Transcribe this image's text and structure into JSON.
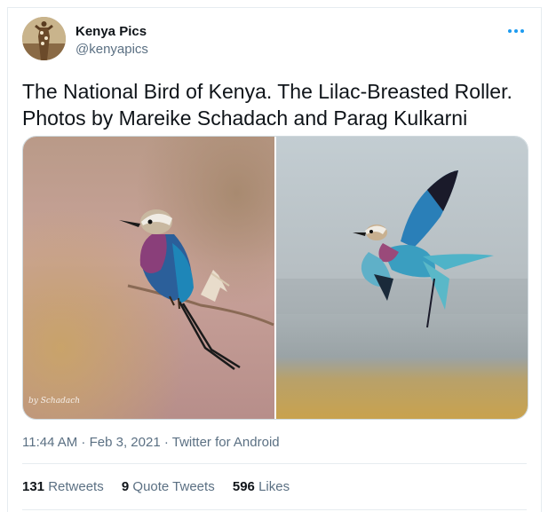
{
  "author": {
    "display_name": "Kenya Pics",
    "handle": "@kenyapics"
  },
  "menu": {
    "more_icon": "ellipsis-icon"
  },
  "tweet": {
    "text_line1": "The National Bird of Kenya. The Lilac-Breasted Roller.",
    "text_line2": "Photos by Mareike Schadach and Parag Kulkarni"
  },
  "media": {
    "photo1": {
      "watermark": "by Schadach"
    },
    "photo2": {}
  },
  "meta": {
    "time": "11:44 AM",
    "sep1": " · ",
    "date": "Feb 3, 2021",
    "sep2": " · ",
    "source": "Twitter for Android"
  },
  "stats": {
    "retweets_count": "131",
    "retweets_label": " Retweets",
    "quotes_count": "9",
    "quotes_label": " Quote Tweets",
    "likes_count": "596",
    "likes_label": " Likes"
  }
}
